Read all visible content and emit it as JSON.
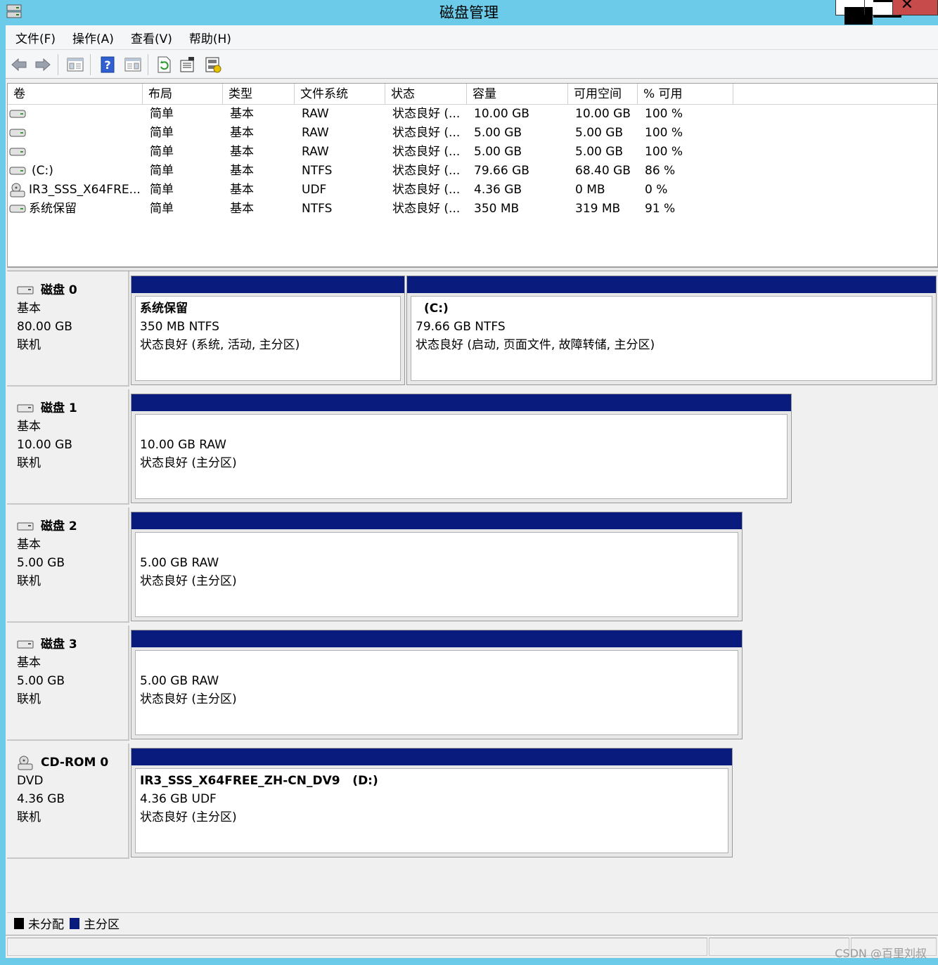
{
  "window": {
    "title": "磁盘管理"
  },
  "menu": [
    "文件(F)",
    "操作(A)",
    "查看(V)",
    "帮助(H)"
  ],
  "volume_table": {
    "columns": [
      "卷",
      "布局",
      "类型",
      "文件系统",
      "状态",
      "容量",
      "可用空间",
      "% 可用"
    ],
    "rows": [
      {
        "volume": "",
        "icon": "drive-icon",
        "layout": "简单",
        "type": "基本",
        "fs": "RAW",
        "status": "状态良好 (...",
        "capacity": "10.00 GB",
        "free": "10.00 GB",
        "pct": "100 %"
      },
      {
        "volume": "",
        "icon": "drive-icon",
        "layout": "简单",
        "type": "基本",
        "fs": "RAW",
        "status": "状态良好 (...",
        "capacity": "5.00 GB",
        "free": "5.00 GB",
        "pct": "100 %"
      },
      {
        "volume": "",
        "icon": "drive-icon",
        "layout": "简单",
        "type": "基本",
        "fs": "RAW",
        "status": "状态良好 (...",
        "capacity": "5.00 GB",
        "free": "5.00 GB",
        "pct": "100 %"
      },
      {
        "volume": "(C:)",
        "icon": "drive-icon",
        "layout": "简单",
        "type": "基本",
        "fs": "NTFS",
        "status": "状态良好 (...",
        "capacity": "79.66 GB",
        "free": "68.40 GB",
        "pct": "86 %"
      },
      {
        "volume": "IR3_SSS_X64FRE...",
        "icon": "cdrom-icon",
        "layout": "简单",
        "type": "基本",
        "fs": "UDF",
        "status": "状态良好 (...",
        "capacity": "4.36 GB",
        "free": "0 MB",
        "pct": "0 %"
      },
      {
        "volume": "系统保留",
        "icon": "drive-icon",
        "layout": "简单",
        "type": "基本",
        "fs": "NTFS",
        "status": "状态良好 (...",
        "capacity": "350 MB",
        "free": "319 MB",
        "pct": "91 %"
      }
    ]
  },
  "disks": [
    {
      "name": "磁盘 0",
      "kind": "基本",
      "size": "80.00 GB",
      "state": "联机",
      "partitions": [
        {
          "label": "系统保留",
          "line2": "350 MB NTFS",
          "line3": "状态良好 (系统, 活动, 主分区)"
        },
        {
          "label": "(C:)",
          "line2": "79.66 GB NTFS",
          "line3": "状态良好 (启动, 页面文件, 故障转储, 主分区)"
        }
      ]
    },
    {
      "name": "磁盘 1",
      "kind": "基本",
      "size": "10.00 GB",
      "state": "联机",
      "partitions": [
        {
          "label": "",
          "line2": "10.00 GB RAW",
          "line3": "状态良好 (主分区)"
        }
      ]
    },
    {
      "name": "磁盘 2",
      "kind": "基本",
      "size": "5.00 GB",
      "state": "联机",
      "partitions": [
        {
          "label": "",
          "line2": "5.00 GB RAW",
          "line3": "状态良好 (主分区)"
        }
      ]
    },
    {
      "name": "磁盘 3",
      "kind": "基本",
      "size": "5.00 GB",
      "state": "联机",
      "partitions": [
        {
          "label": "",
          "line2": "5.00 GB RAW",
          "line3": "状态良好 (主分区)"
        }
      ]
    },
    {
      "name": "CD-ROM 0",
      "kind": "DVD",
      "size": "4.36 GB",
      "state": "联机",
      "partitions": [
        {
          "label": "IR3_SSS_X64FREE_ZH-CN_DV9   (D:)",
          "line2": "4.36 GB UDF",
          "line3": "状态良好 (主分区)"
        }
      ]
    }
  ],
  "legend": {
    "unallocated": "未分配",
    "primary": "主分区",
    "unallocated_color": "#000000",
    "primary_color": "#0a1b7e"
  },
  "watermark": "CSDN @百里刘叔"
}
